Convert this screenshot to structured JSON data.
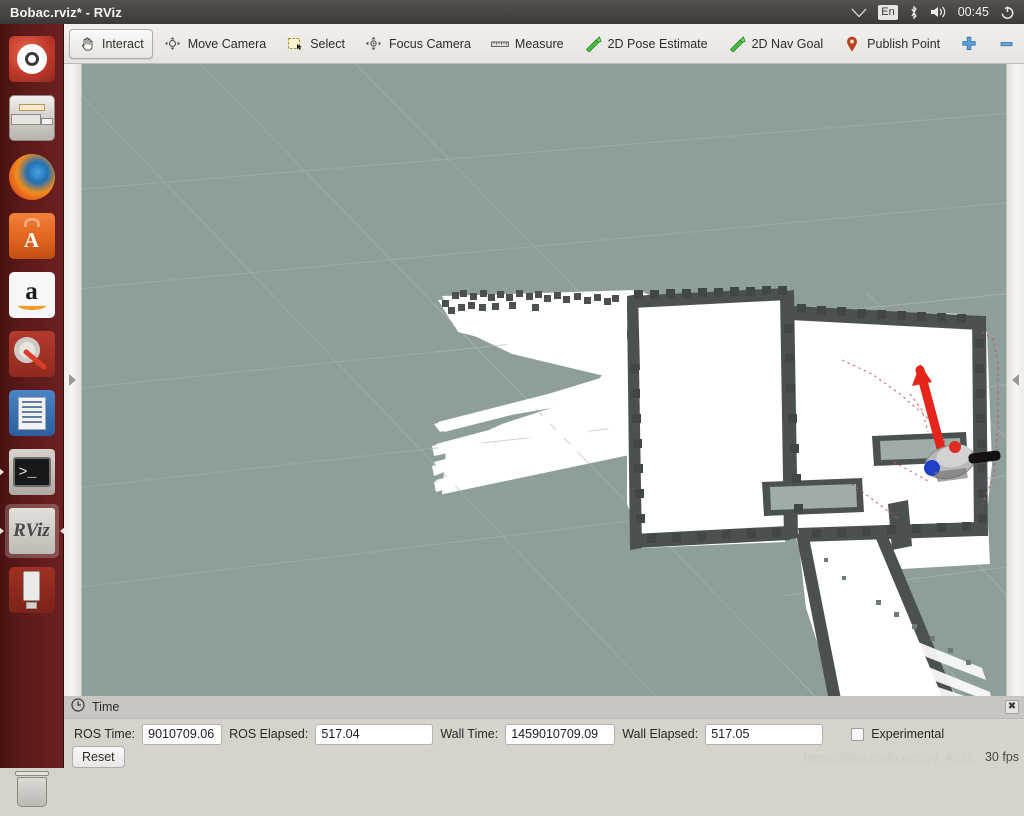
{
  "window": {
    "title": "Bobac.rviz* - RViz"
  },
  "tray": {
    "wifi_icon": "wifi-icon",
    "keyboard_layout": "En",
    "bluetooth_icon": "bluetooth-icon",
    "volume_icon": "volume-icon",
    "clock": "00:45",
    "session_icon": "power-gear-icon"
  },
  "launcher": {
    "items": [
      {
        "name": "ubuntu-dash",
        "label": "Ubuntu Dash",
        "running": false,
        "focused": false
      },
      {
        "name": "files",
        "label": "Files",
        "running": false,
        "focused": false
      },
      {
        "name": "firefox",
        "label": "Firefox Web Browser",
        "running": false,
        "focused": false
      },
      {
        "name": "ubuntu-software",
        "label": "Ubuntu Software",
        "running": false,
        "focused": false
      },
      {
        "name": "amazon",
        "label": "Amazon",
        "running": false,
        "focused": false
      },
      {
        "name": "system-settings",
        "label": "System Settings",
        "running": false,
        "focused": false
      },
      {
        "name": "libreoffice-writer",
        "label": "LibreOffice Writer",
        "running": false,
        "focused": false
      },
      {
        "name": "terminal",
        "label": "Terminal",
        "running": true,
        "focused": false
      },
      {
        "name": "rviz",
        "label": "RViz",
        "running": true,
        "focused": true
      },
      {
        "name": "usb-drive",
        "label": "USB Drive",
        "running": false,
        "focused": false
      },
      {
        "name": "trash",
        "label": "Trash",
        "running": false,
        "focused": false
      }
    ]
  },
  "toolbar": {
    "tools": [
      {
        "label": "Interact",
        "icon": "hand-cursor-icon",
        "active": true
      },
      {
        "label": "Move Camera",
        "icon": "move-camera-icon",
        "active": false
      },
      {
        "label": "Select",
        "icon": "selection-rect-icon",
        "active": false
      },
      {
        "label": "Focus Camera",
        "icon": "focus-camera-icon",
        "active": false
      },
      {
        "label": "Measure",
        "icon": "ruler-icon",
        "active": false
      },
      {
        "label": "2D Pose Estimate",
        "icon": "green-arrow-icon",
        "active": false
      },
      {
        "label": "2D Nav Goal",
        "icon": "green-arrow-icon",
        "active": false
      },
      {
        "label": "Publish Point",
        "icon": "map-pin-icon",
        "active": false
      }
    ],
    "add_tool_icon": "plus-icon",
    "remove_tool_icon": "minus-icon",
    "remove_tool_menu_icon": "chevron-down-icon"
  },
  "render_view": {
    "expand_left_icon": "triangle-right-icon",
    "expand_right_icon": "triangle-left-icon",
    "background_color": "#8e9e9a",
    "free_space_color": "#ffffff",
    "obstacle_color": "#4a4f4e",
    "grid_line_color": "#c9d2d0",
    "scan_color": "#d04040",
    "arrow_color": "#e02b20"
  },
  "time_panel": {
    "title": "Time",
    "clock_icon": "clock-icon",
    "close_icon": "close-icon",
    "fields": [
      {
        "label": "ROS Time:",
        "value": "9010709.06"
      },
      {
        "label": "ROS Elapsed:",
        "value": "517.04"
      },
      {
        "label": "Wall Time:",
        "value": "1459010709.09"
      },
      {
        "label": "Wall Elapsed:",
        "value": "517.05"
      }
    ],
    "ros_time_label": "ROS Time:",
    "ros_time_value": "9010709.06",
    "ros_elapsed_label": "ROS Elapsed:",
    "ros_elapsed_value": "517.04",
    "wall_time_label": "Wall Time:",
    "wall_time_value": "1459010709.09",
    "wall_elapsed_label": "Wall Elapsed:",
    "wall_elapsed_value": "517.05",
    "experimental_label": "Experimental",
    "experimental_checked": false,
    "reset_label": "Reset"
  },
  "status": {
    "fps": "30 fps",
    "watermark": "https://blog.csdn.net/qq_4525"
  }
}
